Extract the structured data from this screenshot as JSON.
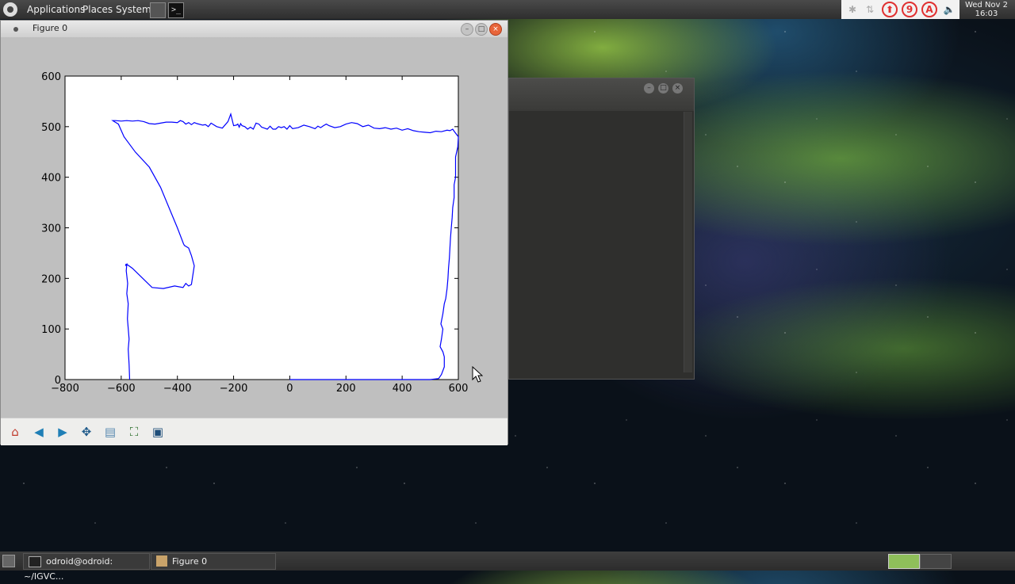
{
  "top_panel": {
    "menus": [
      "Applications",
      "Places",
      "System"
    ],
    "tray": {
      "icons": [
        "bluetooth-icon",
        "network-icon",
        "update-icon",
        "nine-icon",
        "a-icon",
        "volume-icon"
      ],
      "badges": [
        "⬆",
        "9",
        "A"
      ]
    },
    "clock": {
      "line1": "Wed Nov  2",
      "line2": "16:03"
    }
  },
  "figure_window": {
    "title": "Figure 0",
    "chart_data": {
      "type": "line",
      "xlim": [
        -800,
        600
      ],
      "ylim": [
        0,
        600
      ],
      "xticks": [
        -800,
        -600,
        -400,
        -200,
        0,
        200,
        400,
        600
      ],
      "yticks": [
        0,
        100,
        200,
        300,
        400,
        500,
        600
      ],
      "xtick_labels": [
        "−800",
        "−600",
        "−400",
        "−200",
        "0",
        "200",
        "400",
        "600"
      ],
      "ytick_labels": [
        "0",
        "100",
        "200",
        "300",
        "400",
        "500",
        "600"
      ],
      "line_color": "#0000ff",
      "series": [
        {
          "x": [
            -570,
            -572,
            -575,
            -572,
            -578,
            -575,
            -580,
            -577,
            -582,
            -580,
            -585,
            -583,
            -580,
            -560,
            -490,
            -450,
            -410,
            -380,
            -370,
            -360,
            -350,
            -340,
            -350,
            -360,
            -375,
            -378,
            -400,
            -430,
            -460,
            -500,
            -550,
            -590,
            -610,
            -625,
            -630,
            -620,
            -600,
            -580,
            -560,
            -540,
            -520,
            -500,
            -480,
            -460,
            -440,
            -420,
            -400,
            -390,
            -380,
            -370,
            -360,
            -350,
            -340,
            -330,
            -310,
            -300,
            -290,
            -280,
            -260,
            -240,
            -220,
            -210,
            -200,
            -190,
            -185,
            -180,
            -175,
            -170,
            -160,
            -150,
            -140,
            -130,
            -120,
            -110,
            -100,
            -90,
            -80,
            -70,
            -60,
            -50,
            -40,
            -30,
            -20,
            -10,
            0,
            10,
            30,
            50,
            70,
            90,
            100,
            110,
            120,
            130,
            140,
            160,
            180,
            200,
            220,
            240,
            260,
            280,
            300,
            320,
            340,
            360,
            380,
            400,
            420,
            440,
            460,
            480,
            500,
            520,
            540,
            560,
            570,
            580,
            585,
            600,
            598,
            590,
            590,
            585,
            585,
            580,
            578,
            575,
            572,
            570,
            568,
            565,
            563,
            560,
            555,
            550,
            545,
            538,
            545,
            540,
            535,
            545,
            550,
            550,
            540,
            530,
            500,
            400,
            300,
            200,
            100,
            0
          ],
          "y": [
            0,
            30,
            60,
            80,
            120,
            150,
            170,
            190,
            215,
            228,
            225,
            228,
            228,
            220,
            182,
            180,
            185,
            182,
            190,
            185,
            188,
            225,
            245,
            260,
            265,
            268,
            300,
            340,
            380,
            420,
            450,
            480,
            505,
            510,
            512,
            512,
            511,
            512,
            511,
            512,
            510,
            506,
            505,
            507,
            509,
            509,
            508,
            512,
            510,
            505,
            508,
            504,
            508,
            506,
            503,
            504,
            500,
            507,
            500,
            497,
            510,
            525,
            502,
            503,
            505,
            499,
            506,
            502,
            500,
            495,
            499,
            495,
            507,
            505,
            499,
            497,
            495,
            501,
            495,
            495,
            500,
            498,
            500,
            495,
            502,
            496,
            498,
            503,
            500,
            496,
            501,
            498,
            502,
            505,
            502,
            498,
            500,
            505,
            508,
            506,
            500,
            503,
            497,
            496,
            498,
            495,
            497,
            493,
            496,
            492,
            490,
            489,
            488,
            491,
            490,
            493,
            492,
            495,
            491,
            480,
            460,
            440,
            400,
            385,
            360,
            340,
            320,
            300,
            280,
            260,
            240,
            220,
            200,
            180,
            160,
            150,
            130,
            110,
            100,
            80,
            65,
            55,
            45,
            25,
            10,
            2,
            0,
            0,
            0,
            0,
            0,
            0
          ]
        }
      ]
    },
    "toolbar": [
      "home-icon",
      "back-icon",
      "forward-icon",
      "pan-icon",
      "subplots-icon",
      "zoom-icon",
      "save-icon"
    ]
  },
  "bottom_panel": {
    "tasks": [
      {
        "label": "odroid@odroid: ~/IGVC..."
      },
      {
        "label": "Figure 0"
      }
    ]
  }
}
